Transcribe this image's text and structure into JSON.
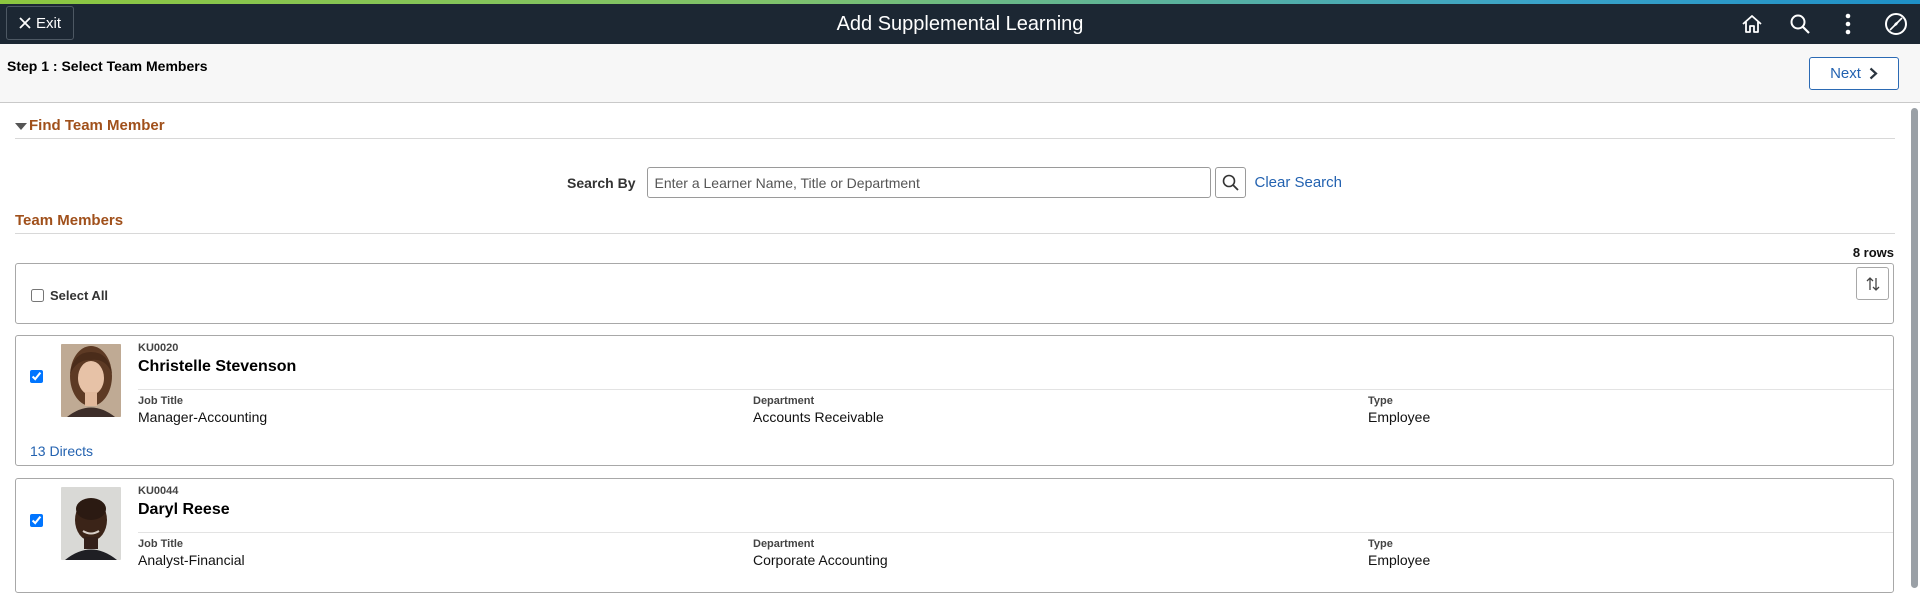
{
  "header": {
    "title": "Add Supplemental Learning",
    "exit_label": "Exit",
    "icons": [
      "home-icon",
      "search-icon",
      "actions-menu-icon",
      "navbar-icon"
    ]
  },
  "step": {
    "title": "Step 1 : Select Team Members",
    "next_label": "Next"
  },
  "find": {
    "header": "Find Team Member",
    "search_label": "Search By",
    "search_placeholder": "Enter a Learner Name, Title or Department",
    "search_value": "",
    "clear_label": "Clear Search"
  },
  "members": {
    "header": "Team Members",
    "row_count": "8 rows",
    "select_all_label": "Select All",
    "select_all_checked": false,
    "items": [
      {
        "id": "KU0020",
        "name": "Christelle Stevenson",
        "checked": true,
        "fields": [
          {
            "label": "Job Title",
            "value": "Manager-Accounting"
          },
          {
            "label": "Department",
            "value": "Accounts Receivable"
          },
          {
            "label": "Type",
            "value": "Employee"
          }
        ],
        "directs": "13 Directs"
      },
      {
        "id": "KU0044",
        "name": "Daryl Reese",
        "checked": true,
        "fields": [
          {
            "label": "Job Title",
            "value": "Analyst-Financial"
          },
          {
            "label": "Department",
            "value": "Corporate Accounting"
          },
          {
            "label": "Type",
            "value": "Employee"
          }
        ]
      }
    ]
  },
  "colors": {
    "banner_bg": "#1c2733",
    "section_header": "#a0501b",
    "link": "#2362b0"
  }
}
